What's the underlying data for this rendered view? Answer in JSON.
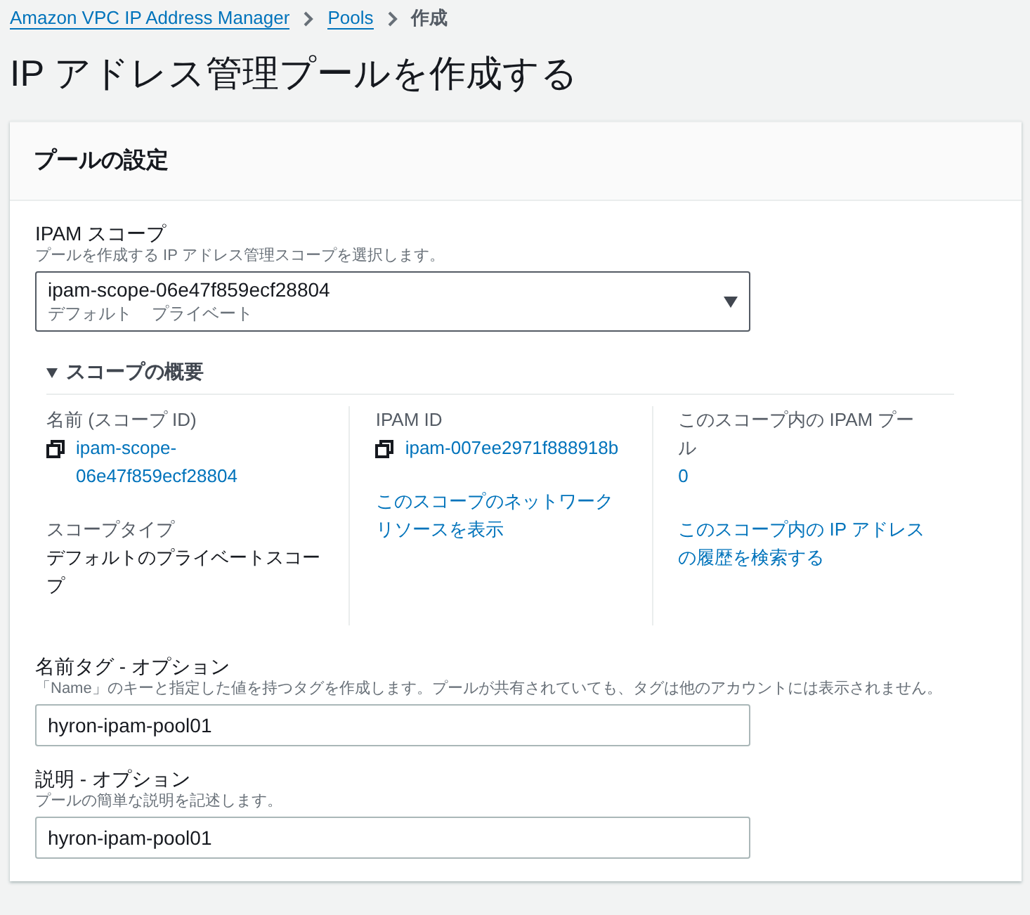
{
  "breadcrumb": [
    {
      "label": "Amazon VPC IP Address Manager",
      "kind": "link"
    },
    {
      "label": "Pools",
      "kind": "link"
    },
    {
      "label": "作成",
      "kind": "current"
    }
  ],
  "page_title": "IP アドレス管理プールを作成する",
  "panel": {
    "title": "プールの設定",
    "scope_field": {
      "label": "IPAM スコープ",
      "hint": "プールを作成する IP アドレス管理スコープを選択します。",
      "value": "ipam-scope-06e47f859ecf28804",
      "value_tags": [
        "デフォルト",
        "プライベート"
      ]
    },
    "summary": {
      "title": "スコープの概要",
      "expanded": true,
      "columns": [
        {
          "items": [
            {
              "label": "名前 (スコープ ID)",
              "value": "ipam-scope-06e47f859ecf28804",
              "kind": "copy"
            },
            {
              "label": "スコープタイプ",
              "value": "デフォルトのプライベートスコープ",
              "kind": "text"
            }
          ]
        },
        {
          "items": [
            {
              "label": "IPAM ID",
              "value": "ipam-007ee2971f888918b",
              "kind": "copy"
            },
            {
              "value": "このスコープのネットワークリソースを表示",
              "kind": "link"
            }
          ]
        },
        {
          "items": [
            {
              "label": "このスコープ内の IPAM プール",
              "value": "0",
              "kind": "link"
            },
            {
              "value": "このスコープ内の IP アドレスの履歴を検索する",
              "kind": "link"
            }
          ]
        }
      ]
    },
    "fields": [
      {
        "label": "名前タグ - オプション",
        "hint": "「Name」のキーと指定した値を持つタグを作成します。プールが共有されていても、タグは他のアカウントには表示されません。",
        "value": "hyron-ipam-pool01"
      },
      {
        "label": "説明 - オプション",
        "hint": "プールの簡単な説明を記述します。",
        "value": "hyron-ipam-pool01"
      }
    ]
  }
}
